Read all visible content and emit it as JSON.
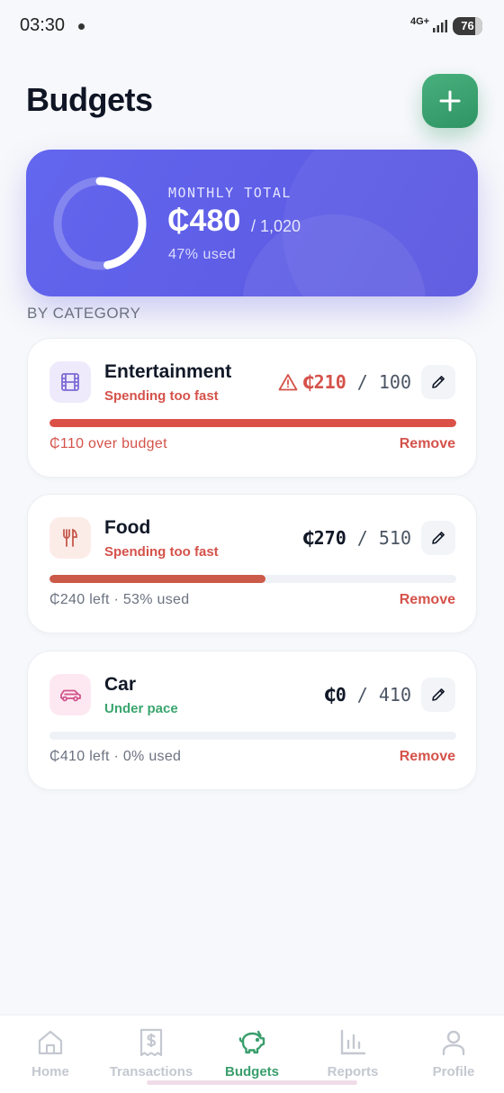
{
  "status_bar": {
    "time": "03:30",
    "network": "4G+",
    "battery": "76",
    "battery_level": 0.76
  },
  "header": {
    "title": "Budgets"
  },
  "summary": {
    "label": "MONTHLY TOTAL",
    "amount": "₵480",
    "limit": "/ 1,020",
    "used_text": "47% used",
    "used_fraction": 0.47
  },
  "section_label": "BY CATEGORY",
  "categories": [
    {
      "name": "Entertainment",
      "status": "Spending too fast",
      "status_color": "#d4524a",
      "spent": "₵210",
      "sep": " / ",
      "limit": "100",
      "spent_color": "#d4524a",
      "icon": "film-icon",
      "icon_bg": "#eeeafb",
      "icon_color": "#7c6bd6",
      "progress": 1.0,
      "bar_color": "#dc5147",
      "footer": "₵110 over budget",
      "footer_color": "#d4524a",
      "remove": "Remove",
      "warning": true
    },
    {
      "name": "Food",
      "status": "Spending too fast",
      "status_color": "#d4524a",
      "spent": "₵270",
      "sep": " / ",
      "limit": "510",
      "spent_color": "#111827",
      "icon": "utensils-icon",
      "icon_bg": "#fcece8",
      "icon_color": "#c5584a",
      "progress": 0.53,
      "bar_color": "#cc5a48",
      "footer": "₵240 left · 53% used",
      "footer_color": "#6b7280",
      "remove": "Remove",
      "warning": false
    },
    {
      "name": "Car",
      "status": "Under pace",
      "status_color": "#3aa56e",
      "spent": "₵0",
      "sep": " / ",
      "limit": "410",
      "spent_color": "#111827",
      "icon": "car-icon",
      "icon_bg": "#fde8f1",
      "icon_color": "#d1538c",
      "progress": 0,
      "bar_color": "#d1538c",
      "footer": "₵410 left · 0% used",
      "footer_color": "#6b7280",
      "remove": "Remove",
      "warning": false
    }
  ],
  "nav": [
    {
      "label": "Home",
      "icon": "home-icon",
      "active": false
    },
    {
      "label": "Transactions",
      "icon": "receipt-icon",
      "active": false
    },
    {
      "label": "Budgets",
      "icon": "piggy-bank-icon",
      "active": true
    },
    {
      "label": "Reports",
      "icon": "bar-chart-icon",
      "active": false
    },
    {
      "label": "Profile",
      "icon": "user-icon",
      "active": false
    }
  ],
  "colors": {
    "accent": "#3a9e6c",
    "nav_inactive": "#c4c8d0",
    "card_gradient": "#5f5ee9"
  }
}
